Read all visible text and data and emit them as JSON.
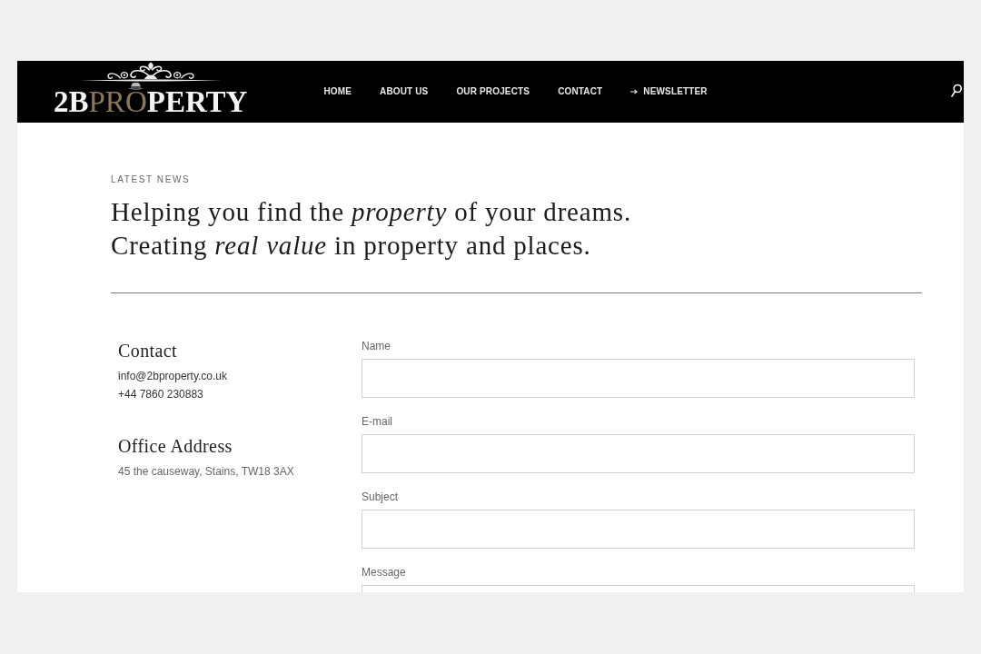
{
  "header": {
    "logo": {
      "lead": "2B",
      "accent": "PRO",
      "tail": "PERTY"
    },
    "nav": [
      {
        "label": "HOME",
        "kind": "link"
      },
      {
        "label": "ABOUT US",
        "kind": "link"
      },
      {
        "label": "OUR PROJECTS",
        "kind": "link"
      },
      {
        "label": "CONTACT",
        "kind": "link"
      },
      {
        "label": "NEWSLETTER",
        "kind": "arrow-link"
      }
    ]
  },
  "intro": {
    "eyebrow": "LATEST NEWS",
    "headline": [
      "Helping you find the *property* of your dreams.",
      "Creating *real value* in property and places."
    ]
  },
  "contact": {
    "title": "Contact",
    "email": "info@2bproperty.co.uk",
    "phone": "+44 7860 230883"
  },
  "office": {
    "title": "Office Address",
    "address": "45 the causeway, Stains, TW18 3AX"
  },
  "form": {
    "fields": [
      {
        "label": "Name",
        "kind": "input"
      },
      {
        "label": "E-mail",
        "kind": "input"
      },
      {
        "label": "Subject",
        "kind": "input"
      },
      {
        "label": "Message",
        "kind": "textarea"
      }
    ]
  }
}
